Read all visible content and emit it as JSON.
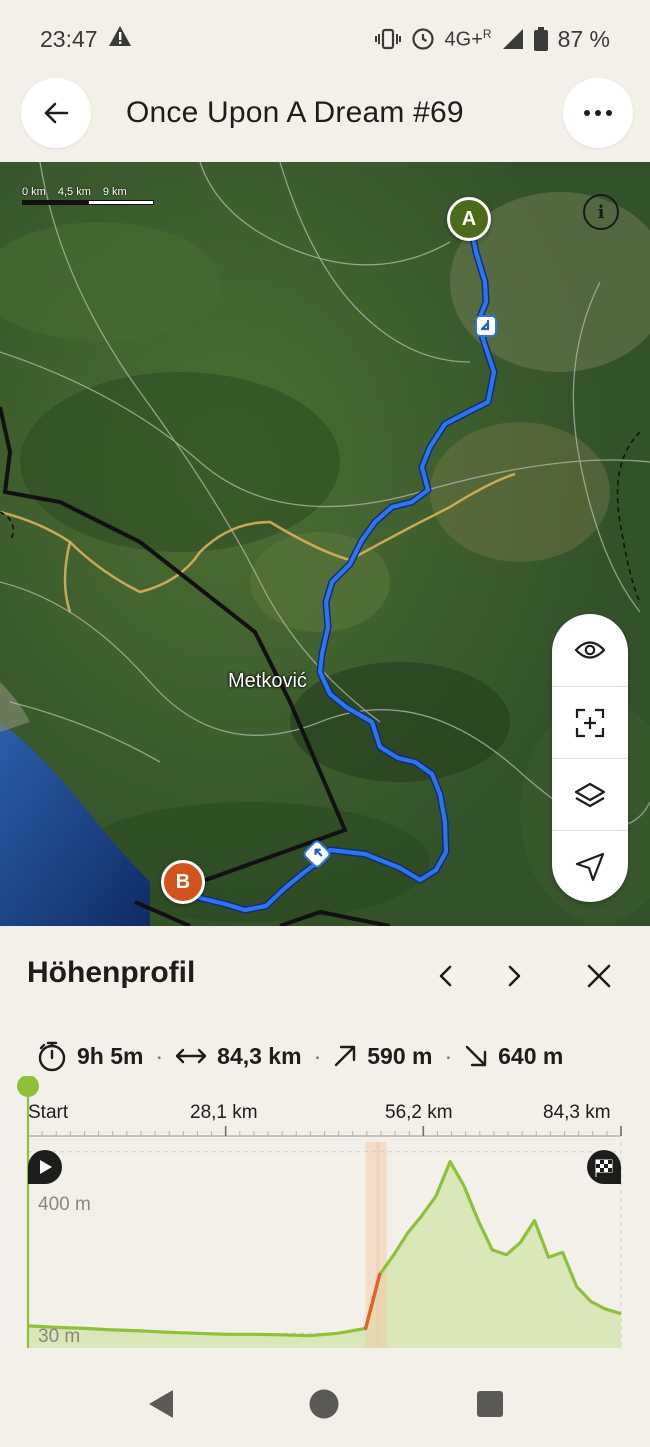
{
  "status_bar": {
    "time": "23:47",
    "network": "4G+",
    "roaming": "R",
    "battery": "87 %"
  },
  "header": {
    "title": "Once Upon A Dream #69"
  },
  "map": {
    "scale_labels": [
      "0 km",
      "4,5 km",
      "9 km"
    ],
    "city_label": "Metković",
    "start_marker": "A",
    "end_marker": "B",
    "route_color": "#1d5fd6",
    "controls": [
      "eye-icon",
      "recenter-icon",
      "layers-icon",
      "navigate-icon"
    ]
  },
  "elevation_panel": {
    "title": "Höhenprofil",
    "stats": {
      "duration": "9h 5m",
      "distance": "84,3 km",
      "ascent": "590 m",
      "descent": "640 m"
    },
    "distance_axis": [
      "Start",
      "28,1 km",
      "56,2 km",
      "84,3 km"
    ],
    "y_labels": [
      "400 m",
      "30 m"
    ],
    "line_color": "#8fc03a",
    "fill_color": "#d4e5b0"
  },
  "chart_data": {
    "type": "area",
    "x": [
      0,
      4,
      8,
      12,
      16,
      20,
      24,
      28,
      32,
      36,
      40,
      44,
      48,
      50,
      52,
      54,
      56,
      58,
      60,
      62,
      64,
      66,
      68,
      70,
      72,
      74,
      76,
      78,
      80,
      82,
      84.3
    ],
    "values": [
      45,
      42,
      40,
      37,
      35,
      32,
      30,
      28,
      28,
      27,
      25,
      30,
      40,
      150,
      190,
      235,
      270,
      310,
      380,
      330,
      260,
      200,
      190,
      215,
      260,
      185,
      195,
      125,
      95,
      80,
      70
    ],
    "ylabel": "",
    "y_ticks": [
      "400 m",
      "30 m"
    ],
    "x_ticks": [
      "Start",
      "28,1 km",
      "56,2 km",
      "84,3 km"
    ],
    "xlim": [
      0,
      84.3
    ],
    "ylim": [
      0,
      420
    ]
  }
}
